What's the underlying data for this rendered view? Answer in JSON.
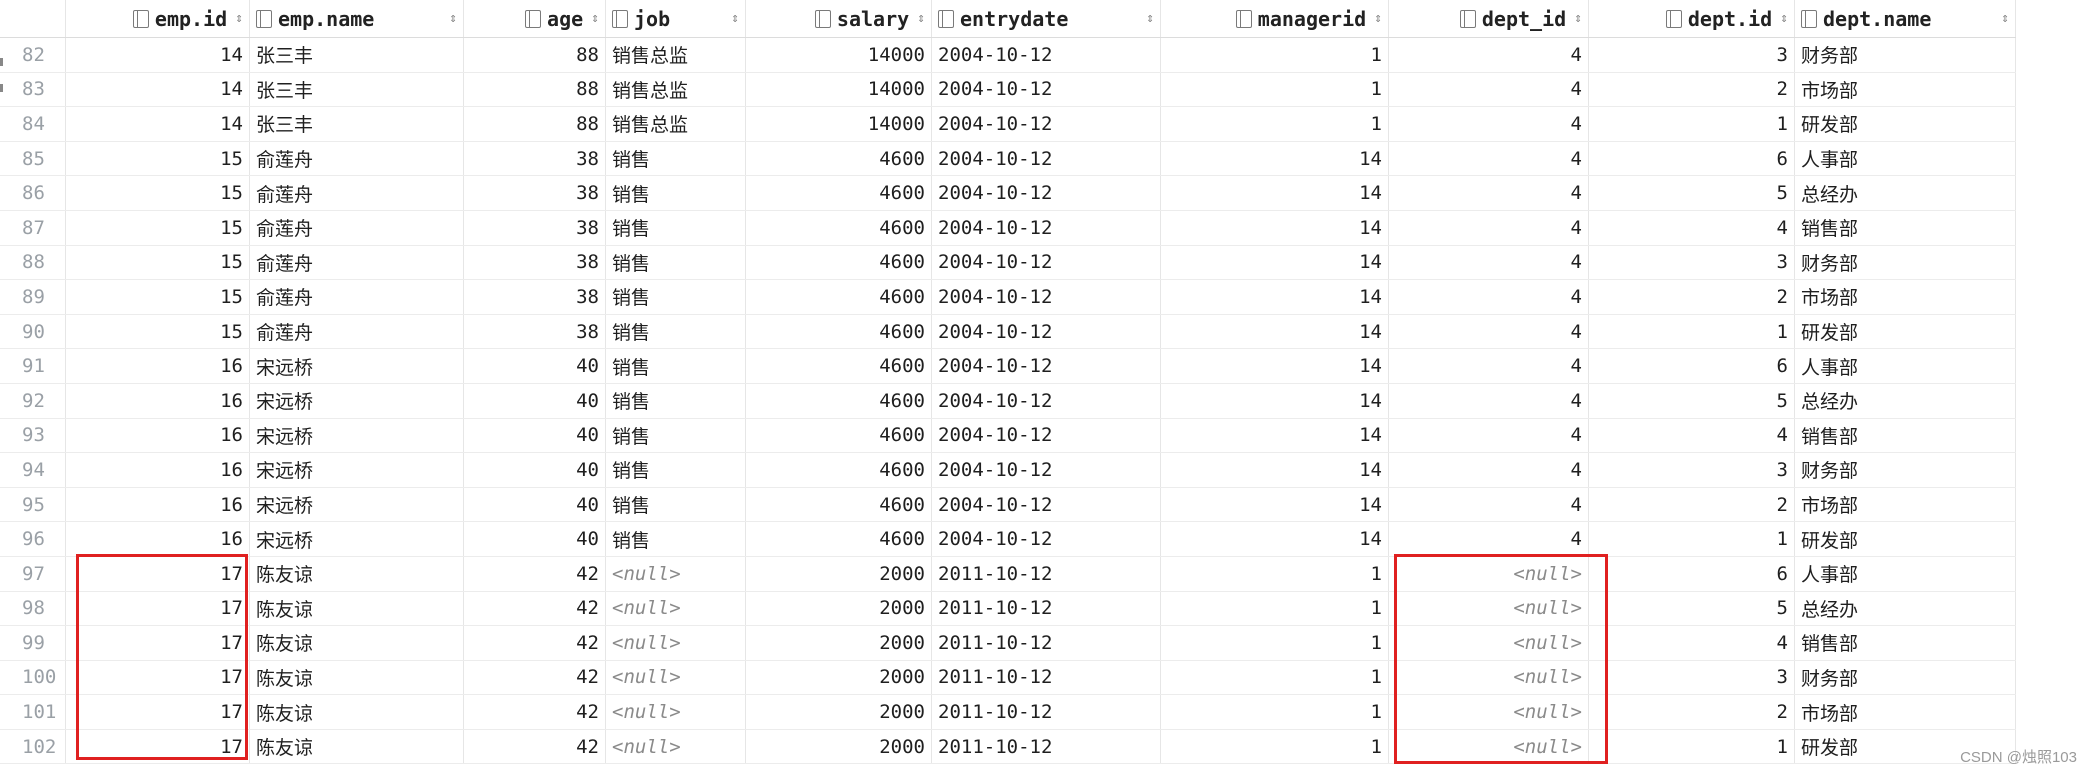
{
  "columns": [
    {
      "key": "emp_id",
      "label": "emp.id",
      "align": "num"
    },
    {
      "key": "emp_name",
      "label": "emp.name",
      "align": "txt"
    },
    {
      "key": "age",
      "label": "age",
      "align": "num"
    },
    {
      "key": "job",
      "label": "job",
      "align": "txt"
    },
    {
      "key": "salary",
      "label": "salary",
      "align": "num"
    },
    {
      "key": "entrydate",
      "label": "entrydate",
      "align": "txt"
    },
    {
      "key": "managerid",
      "label": "managerid",
      "align": "num"
    },
    {
      "key": "dept_id",
      "label": "dept_id",
      "align": "num"
    },
    {
      "key": "dept_id2",
      "label": "dept.id",
      "align": "num"
    },
    {
      "key": "dept_name",
      "label": "dept.name",
      "align": "txt"
    }
  ],
  "sort_glyph": "⇕",
  "null_text": "<null>",
  "rows": [
    {
      "n": "82",
      "emp_id": "14",
      "emp_name": "张三丰",
      "age": "88",
      "job": "销售总监",
      "salary": "14000",
      "entrydate": "2004-10-12",
      "managerid": "1",
      "dept_id": "4",
      "dept_id2": "3",
      "dept_name": "财务部"
    },
    {
      "n": "83",
      "emp_id": "14",
      "emp_name": "张三丰",
      "age": "88",
      "job": "销售总监",
      "salary": "14000",
      "entrydate": "2004-10-12",
      "managerid": "1",
      "dept_id": "4",
      "dept_id2": "2",
      "dept_name": "市场部"
    },
    {
      "n": "84",
      "emp_id": "14",
      "emp_name": "张三丰",
      "age": "88",
      "job": "销售总监",
      "salary": "14000",
      "entrydate": "2004-10-12",
      "managerid": "1",
      "dept_id": "4",
      "dept_id2": "1",
      "dept_name": "研发部"
    },
    {
      "n": "85",
      "emp_id": "15",
      "emp_name": "俞莲舟",
      "age": "38",
      "job": "销售",
      "salary": "4600",
      "entrydate": "2004-10-12",
      "managerid": "14",
      "dept_id": "4",
      "dept_id2": "6",
      "dept_name": "人事部"
    },
    {
      "n": "86",
      "emp_id": "15",
      "emp_name": "俞莲舟",
      "age": "38",
      "job": "销售",
      "salary": "4600",
      "entrydate": "2004-10-12",
      "managerid": "14",
      "dept_id": "4",
      "dept_id2": "5",
      "dept_name": "总经办"
    },
    {
      "n": "87",
      "emp_id": "15",
      "emp_name": "俞莲舟",
      "age": "38",
      "job": "销售",
      "salary": "4600",
      "entrydate": "2004-10-12",
      "managerid": "14",
      "dept_id": "4",
      "dept_id2": "4",
      "dept_name": "销售部"
    },
    {
      "n": "88",
      "emp_id": "15",
      "emp_name": "俞莲舟",
      "age": "38",
      "job": "销售",
      "salary": "4600",
      "entrydate": "2004-10-12",
      "managerid": "14",
      "dept_id": "4",
      "dept_id2": "3",
      "dept_name": "财务部"
    },
    {
      "n": "89",
      "emp_id": "15",
      "emp_name": "俞莲舟",
      "age": "38",
      "job": "销售",
      "salary": "4600",
      "entrydate": "2004-10-12",
      "managerid": "14",
      "dept_id": "4",
      "dept_id2": "2",
      "dept_name": "市场部"
    },
    {
      "n": "90",
      "emp_id": "15",
      "emp_name": "俞莲舟",
      "age": "38",
      "job": "销售",
      "salary": "4600",
      "entrydate": "2004-10-12",
      "managerid": "14",
      "dept_id": "4",
      "dept_id2": "1",
      "dept_name": "研发部"
    },
    {
      "n": "91",
      "emp_id": "16",
      "emp_name": "宋远桥",
      "age": "40",
      "job": "销售",
      "salary": "4600",
      "entrydate": "2004-10-12",
      "managerid": "14",
      "dept_id": "4",
      "dept_id2": "6",
      "dept_name": "人事部"
    },
    {
      "n": "92",
      "emp_id": "16",
      "emp_name": "宋远桥",
      "age": "40",
      "job": "销售",
      "salary": "4600",
      "entrydate": "2004-10-12",
      "managerid": "14",
      "dept_id": "4",
      "dept_id2": "5",
      "dept_name": "总经办"
    },
    {
      "n": "93",
      "emp_id": "16",
      "emp_name": "宋远桥",
      "age": "40",
      "job": "销售",
      "salary": "4600",
      "entrydate": "2004-10-12",
      "managerid": "14",
      "dept_id": "4",
      "dept_id2": "4",
      "dept_name": "销售部"
    },
    {
      "n": "94",
      "emp_id": "16",
      "emp_name": "宋远桥",
      "age": "40",
      "job": "销售",
      "salary": "4600",
      "entrydate": "2004-10-12",
      "managerid": "14",
      "dept_id": "4",
      "dept_id2": "3",
      "dept_name": "财务部"
    },
    {
      "n": "95",
      "emp_id": "16",
      "emp_name": "宋远桥",
      "age": "40",
      "job": "销售",
      "salary": "4600",
      "entrydate": "2004-10-12",
      "managerid": "14",
      "dept_id": "4",
      "dept_id2": "2",
      "dept_name": "市场部"
    },
    {
      "n": "96",
      "emp_id": "16",
      "emp_name": "宋远桥",
      "age": "40",
      "job": "销售",
      "salary": "4600",
      "entrydate": "2004-10-12",
      "managerid": "14",
      "dept_id": "4",
      "dept_id2": "1",
      "dept_name": "研发部"
    },
    {
      "n": "97",
      "emp_id": "17",
      "emp_name": "陈友谅",
      "age": "42",
      "job": null,
      "salary": "2000",
      "entrydate": "2011-10-12",
      "managerid": "1",
      "dept_id": null,
      "dept_id2": "6",
      "dept_name": "人事部"
    },
    {
      "n": "98",
      "emp_id": "17",
      "emp_name": "陈友谅",
      "age": "42",
      "job": null,
      "salary": "2000",
      "entrydate": "2011-10-12",
      "managerid": "1",
      "dept_id": null,
      "dept_id2": "5",
      "dept_name": "总经办"
    },
    {
      "n": "99",
      "emp_id": "17",
      "emp_name": "陈友谅",
      "age": "42",
      "job": null,
      "salary": "2000",
      "entrydate": "2011-10-12",
      "managerid": "1",
      "dept_id": null,
      "dept_id2": "4",
      "dept_name": "销售部"
    },
    {
      "n": "100",
      "emp_id": "17",
      "emp_name": "陈友谅",
      "age": "42",
      "job": null,
      "salary": "2000",
      "entrydate": "2011-10-12",
      "managerid": "1",
      "dept_id": null,
      "dept_id2": "3",
      "dept_name": "财务部"
    },
    {
      "n": "101",
      "emp_id": "17",
      "emp_name": "陈友谅",
      "age": "42",
      "job": null,
      "salary": "2000",
      "entrydate": "2011-10-12",
      "managerid": "1",
      "dept_id": null,
      "dept_id2": "2",
      "dept_name": "市场部"
    },
    {
      "n": "102",
      "emp_id": "17",
      "emp_name": "陈友谅",
      "age": "42",
      "job": null,
      "salary": "2000",
      "entrydate": "2011-10-12",
      "managerid": "1",
      "dept_id": null,
      "dept_id2": "1",
      "dept_name": "研发部"
    }
  ],
  "highlight_color": "#e02020",
  "watermark": "CSDN @烛照103"
}
